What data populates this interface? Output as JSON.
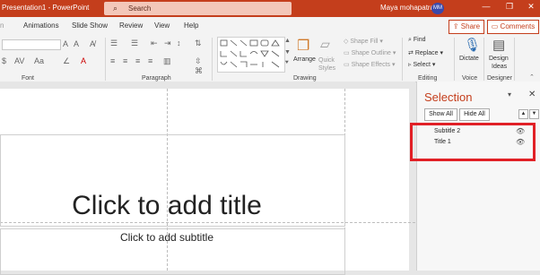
{
  "app": {
    "title": "Presentation1 - PowerPoint",
    "search_placeholder": "Search",
    "user_name": "Maya mohapatra",
    "user_initials": "MM",
    "window_buttons": [
      "—",
      "❐",
      "✕"
    ]
  },
  "tabs": [
    "Animations",
    "Slide Show",
    "Review",
    "View",
    "Help"
  ],
  "actions": {
    "share": "Share",
    "comments": "Comments"
  },
  "ribbon": {
    "groups": [
      "Font",
      "Paragraph",
      "Drawing",
      "Editing",
      "Voice",
      "Designer"
    ],
    "drawing": {
      "arrange": "Arrange",
      "quick_styles": "Quick Styles",
      "shape_fill": "Shape Fill",
      "shape_outline": "Shape Outline",
      "shape_effects": "Shape Effects"
    },
    "editing": {
      "find": "Find",
      "replace": "Replace",
      "select": "Select"
    },
    "voice": {
      "dictate": "Dictate"
    },
    "designer": {
      "design_ideas_1": "Design",
      "design_ideas_2": "Ideas"
    }
  },
  "slide": {
    "title_placeholder": "Click to add title",
    "subtitle_placeholder": "Click to add subtitle"
  },
  "selection_pane": {
    "title": "Selection",
    "show_all": "Show All",
    "hide_all": "Hide All",
    "items": [
      {
        "label": "Subtitle 2",
        "icon": "eye-icon"
      },
      {
        "label": "Title 1",
        "icon": "eye-icon"
      }
    ]
  },
  "colors": {
    "accent": "#c43e1c",
    "highlight": "#e12026"
  }
}
